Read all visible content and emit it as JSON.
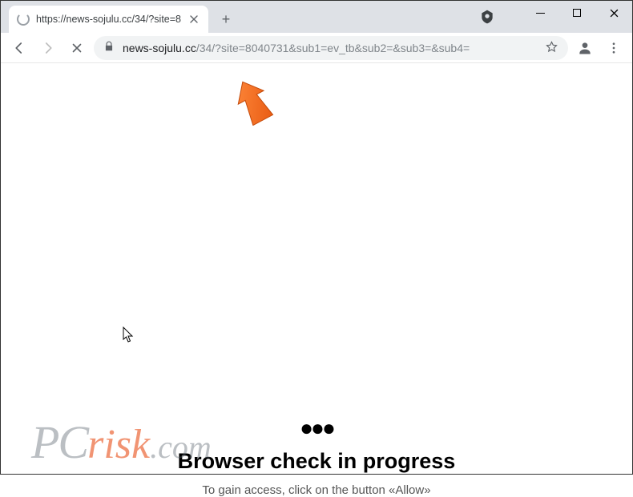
{
  "window": {
    "tab_title": "https://news-sojulu.cc/34/?site=8",
    "url_domain": "news-sojulu.cc",
    "url_path": "/34/?site=8040731&sub1=ev_tb&sub2=&sub3=&sub4="
  },
  "page": {
    "dots": "●●●",
    "headline": "Browser check in progress",
    "subline": "To gain access, click on the button «Allow»"
  },
  "watermark": {
    "part1": "PC",
    "part2": "risk",
    "part3": ".com"
  }
}
